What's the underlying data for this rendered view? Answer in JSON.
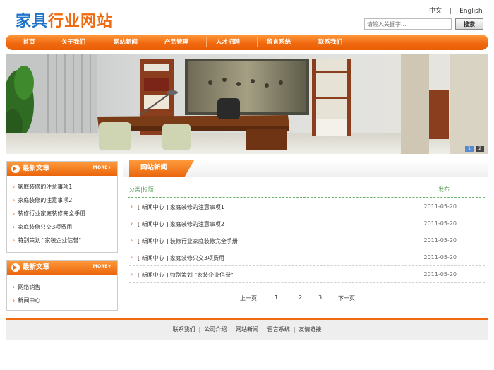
{
  "header": {
    "logo_part1": "家具",
    "logo_part2": "行业网站",
    "lang_cn": "中文",
    "lang_sep": "|",
    "lang_en": "English",
    "search_placeholder": "请输入关键字...",
    "search_button": "搜索"
  },
  "nav": {
    "items": [
      "首页",
      "关于我们",
      "网站新闻",
      "产品管理",
      "人才招聘",
      "留言系统",
      "联系我们"
    ]
  },
  "banner": {
    "dots": [
      "1",
      "2"
    ]
  },
  "sidebar": {
    "box1": {
      "title": "最新文章",
      "more": "MORE+",
      "items": [
        "家庭装修的注意事项1",
        "家庭装修的注意事项2",
        "装修行业家庭装修完全手册",
        "家庭装修只交3项费用",
        "特别策划 \"家装企业信誉\""
      ]
    },
    "box2": {
      "title": "最新文章",
      "more": "MORE+",
      "items": [
        "网络销售",
        "新闻中心"
      ]
    }
  },
  "main": {
    "tab_title": "网站新闻",
    "col_title": "分类|标题",
    "col_date": "发布",
    "rows": [
      {
        "text": "[ 新闻中心 ] 家庭装修的注意事项1",
        "date": "2011-05-20"
      },
      {
        "text": "[ 新闻中心 ] 家庭装修的注意事项2",
        "date": "2011-05-20"
      },
      {
        "text": "[ 新闻中心 ] 装修行业家庭装修完全手册",
        "date": "2011-05-20"
      },
      {
        "text": "[ 新闻中心 ] 家庭装修只交3项费用",
        "date": "2011-05-20"
      },
      {
        "text": "[ 新闻中心 ] 特别策划 \"家装企业信誉\"",
        "date": "2011-05-20"
      }
    ],
    "pager": {
      "prev": "上一页",
      "p1": "1",
      "p2": "2",
      "p3": "3",
      "next": "下一页"
    }
  },
  "footer": {
    "links": [
      "联系我们",
      "公司介绍",
      "网站新闻",
      "留言系统",
      "友情链接"
    ],
    "sep": "|"
  },
  "colors": {
    "brand_blue": "#1f74c9",
    "brand_orange": "#f06a10",
    "column_header_green": "#58a05a"
  }
}
